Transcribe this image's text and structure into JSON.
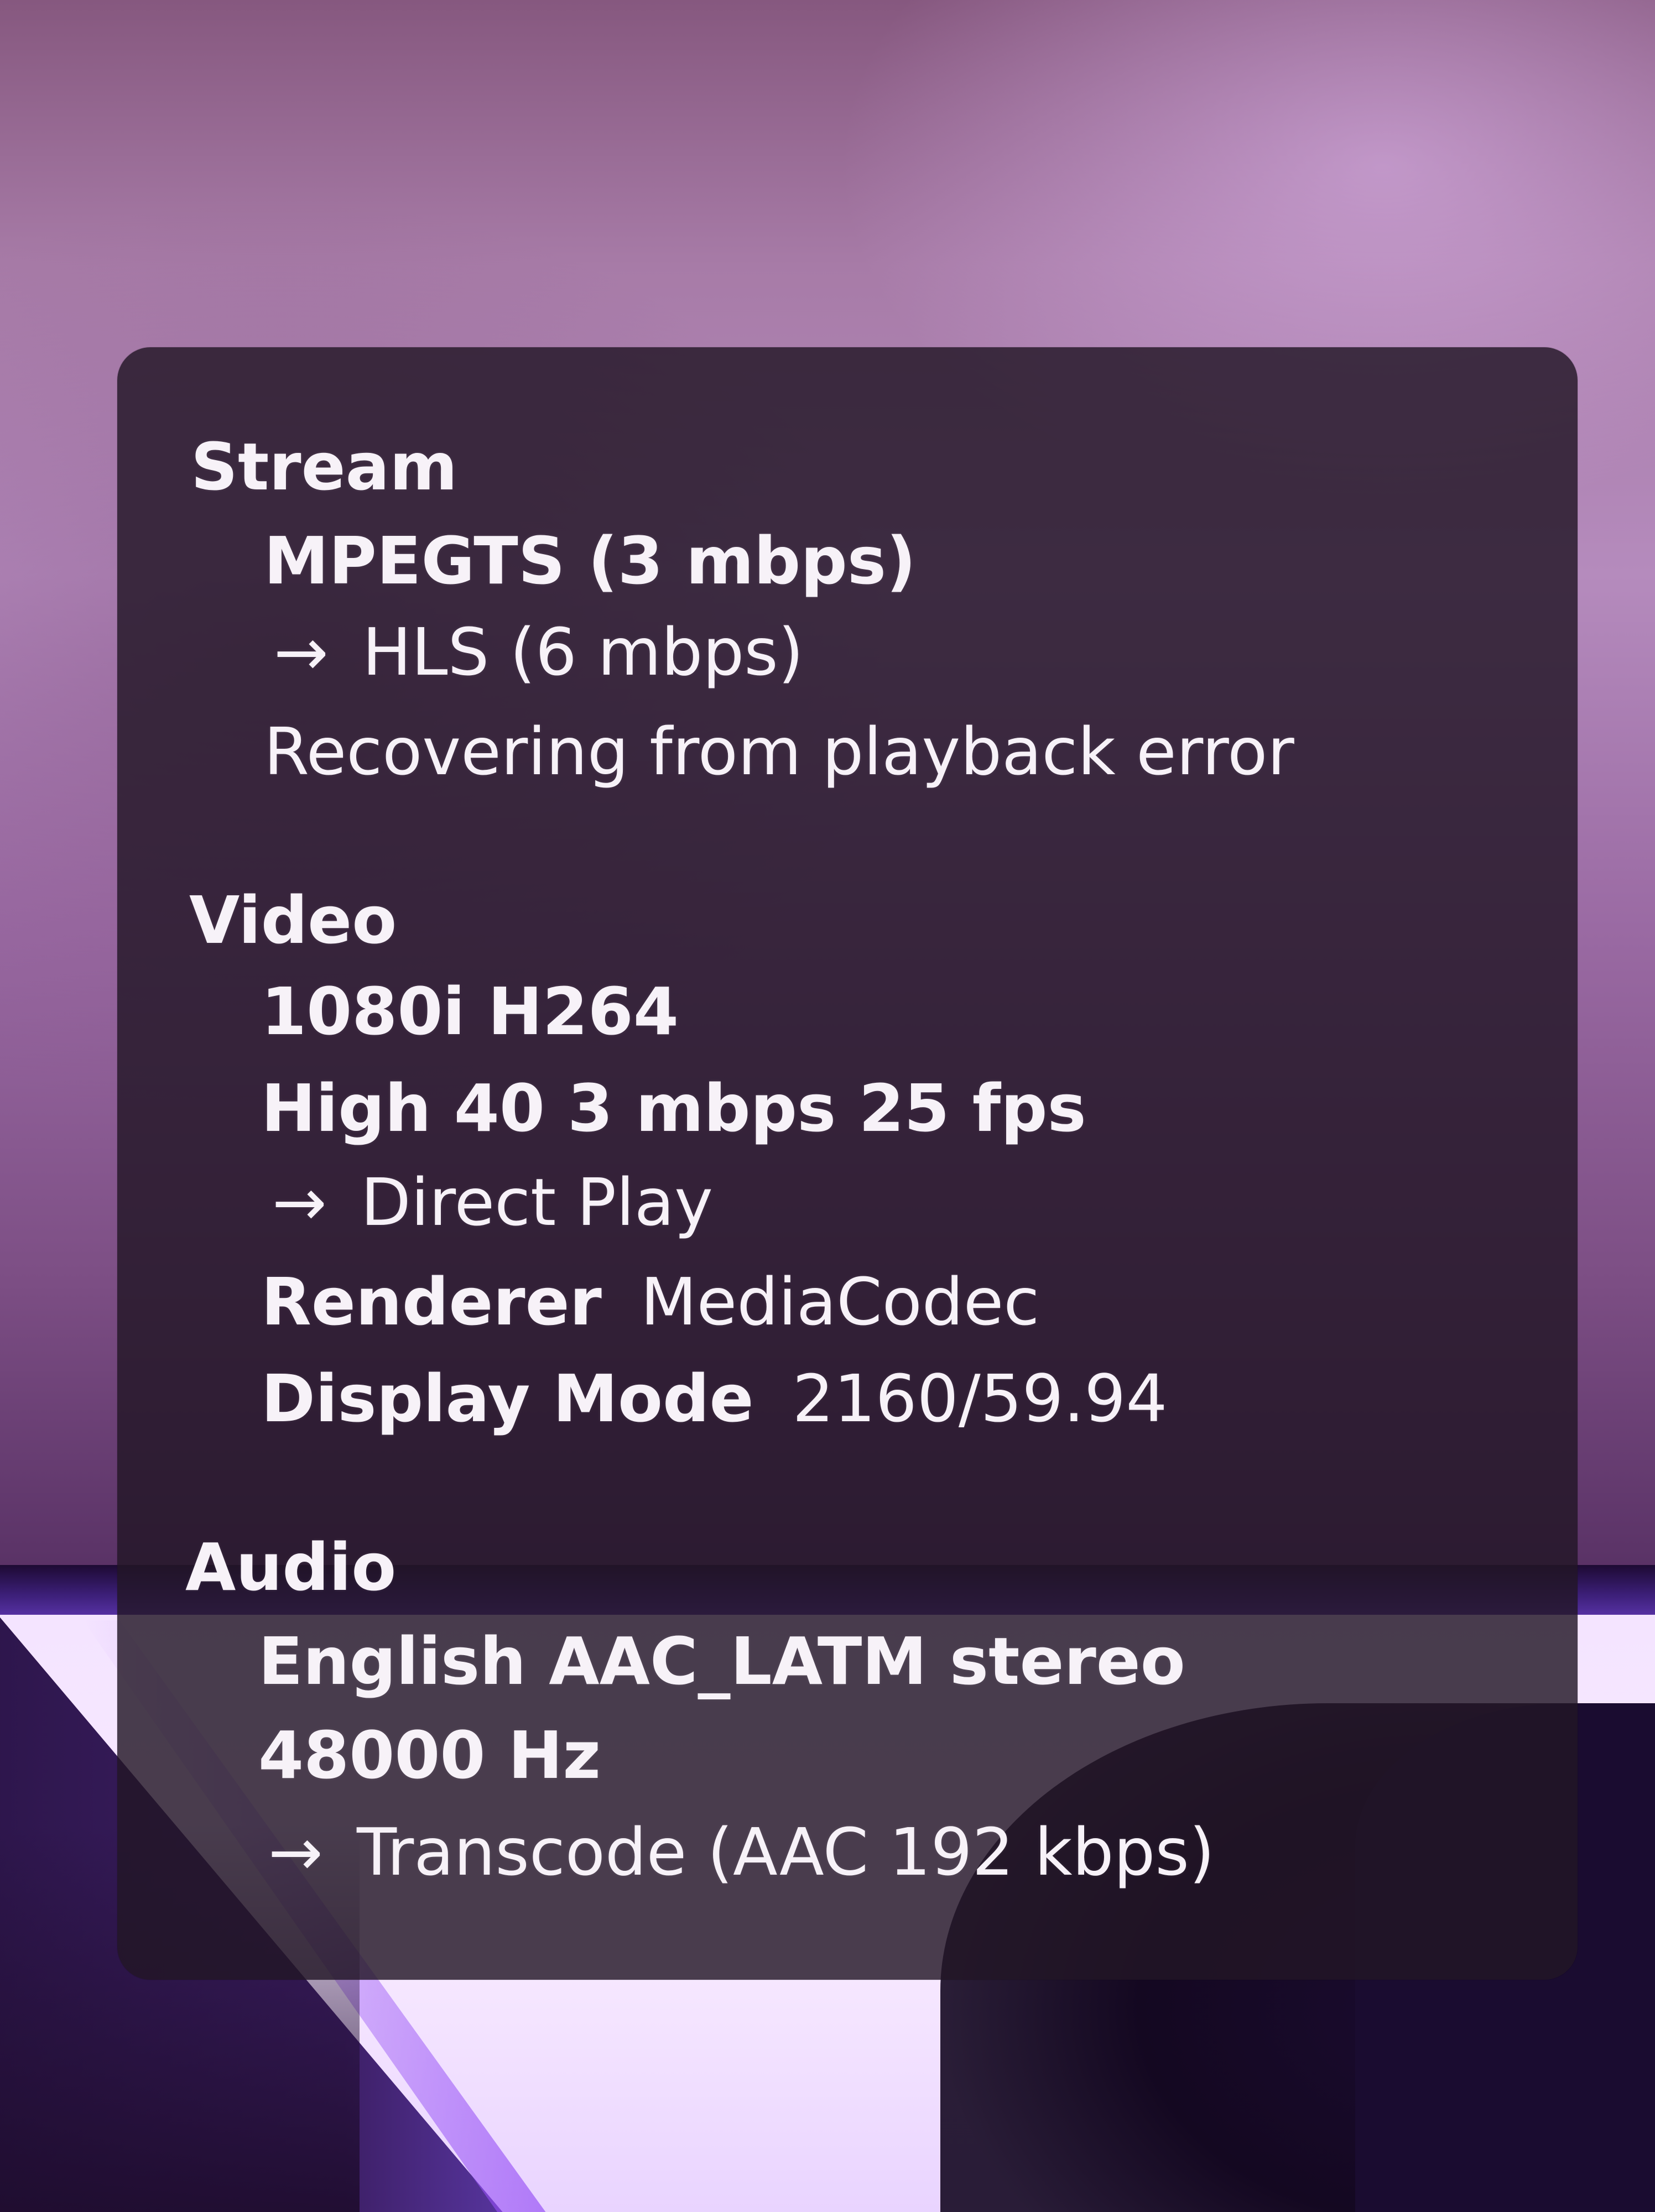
{
  "stream": {
    "heading": "Stream",
    "container": "MPEGTS (3 mbps)",
    "arrow": "→",
    "target": "HLS (6 mbps)",
    "status": "Recovering from playback error"
  },
  "video": {
    "heading": "Video",
    "format": "1080i H264",
    "profile": "High 40 3 mbps 25 fps",
    "arrow": "→",
    "mode": "Direct Play",
    "renderer_label": "Renderer",
    "renderer_value": "MediaCodec",
    "display_label": "Display Mode",
    "display_value": "2160/59.94"
  },
  "audio": {
    "heading": "Audio",
    "track": "English AAC_LATM stereo",
    "rate": "48000 Hz",
    "arrow": "→",
    "mode": "Transcode (AAC 192 kbps)"
  }
}
